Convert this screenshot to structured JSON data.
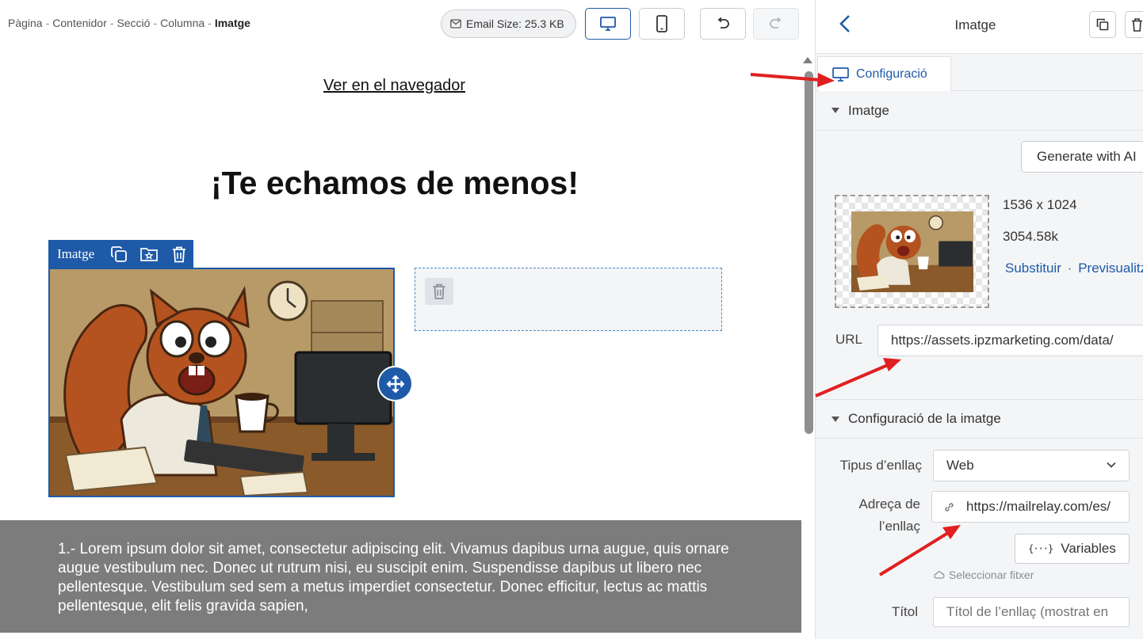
{
  "breadcrumb": {
    "items": [
      "Pàgina",
      "Contenidor",
      "Secció",
      "Columna"
    ],
    "current": "Imatge",
    "separator": "-"
  },
  "toolbar": {
    "email_size": "Email Size: 25.3 KB",
    "desktop_icon": "desktop-icon",
    "mobile_icon": "mobile-icon",
    "undo_icon": "undo-icon",
    "redo_icon": "redo-icon"
  },
  "canvas": {
    "browser_link": "Ver en el navegador",
    "headline": "¡Te echamos de menos!",
    "image_toolbar_label": "Imatge",
    "body_text": "1.- Lorem ipsum dolor sit amet, consectetur adipiscing elit. Vivamus dapibus urna augue, quis ornare augue vestibulum nec. Donec ut rutrum nisi, eu suscipit enim. Suspendisse dapibus ut libero nec pellentesque. Vestibulum sed sem a metus imperdiet consectetur. Donec efficitur, lectus ac mattis pellentesque, elit felis gravida sapien,"
  },
  "panel": {
    "title": "Imatge",
    "tab_label": "Configuració",
    "section_image": "Imatge",
    "generate_button": "Generate with AI",
    "image_dimensions": "1536 x 1024",
    "image_size": "3054.58k",
    "replace_link": "Substituir",
    "preview_link": "Previsualitzar",
    "url_label": "URL",
    "url_value": "https://assets.ipzmarketing.com/data/",
    "section_config": "Configuració de la imatge",
    "link_type_label": "Tipus d’enllaç",
    "link_type_value": "Web",
    "link_address_label_1": "Adreça de",
    "link_address_label_2": "l’enllaç",
    "link_address_value": "https://mailrelay.com/es/",
    "variables_button": "Variables",
    "select_file": "Seleccionar fitxer",
    "title_label": "Títol",
    "title_placeholder": "Títol de l’enllaç (mostrat en"
  },
  "colors": {
    "accent": "#1e5aa8",
    "annotation_arrow": "#e02020",
    "section_gray": "#7c7c7c"
  }
}
